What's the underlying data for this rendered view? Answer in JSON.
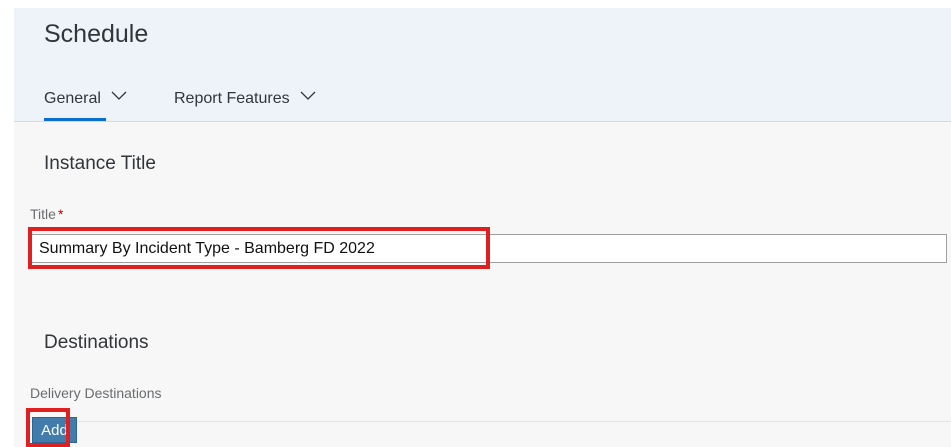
{
  "header": {
    "title": "Schedule",
    "tabs": [
      {
        "label": "General",
        "active": true,
        "icon": "chevron-down-icon"
      },
      {
        "label": "Report Features",
        "active": false,
        "icon": "chevron-down-icon"
      }
    ]
  },
  "instance_section": {
    "title": "Instance Title",
    "field_label": "Title",
    "required_marker": "*",
    "title_value": "Summary By Incident Type - Bamberg FD 2022"
  },
  "destinations_section": {
    "title": "Destinations",
    "field_label": "Delivery Destinations",
    "add_label": "Add"
  },
  "colors": {
    "accent": "#0a6ed1",
    "button_bg": "#427cac",
    "header_bg": "#edf3f8",
    "content_bg": "#f7f7f7",
    "required": "#bb0000",
    "highlight": "#e02020"
  }
}
